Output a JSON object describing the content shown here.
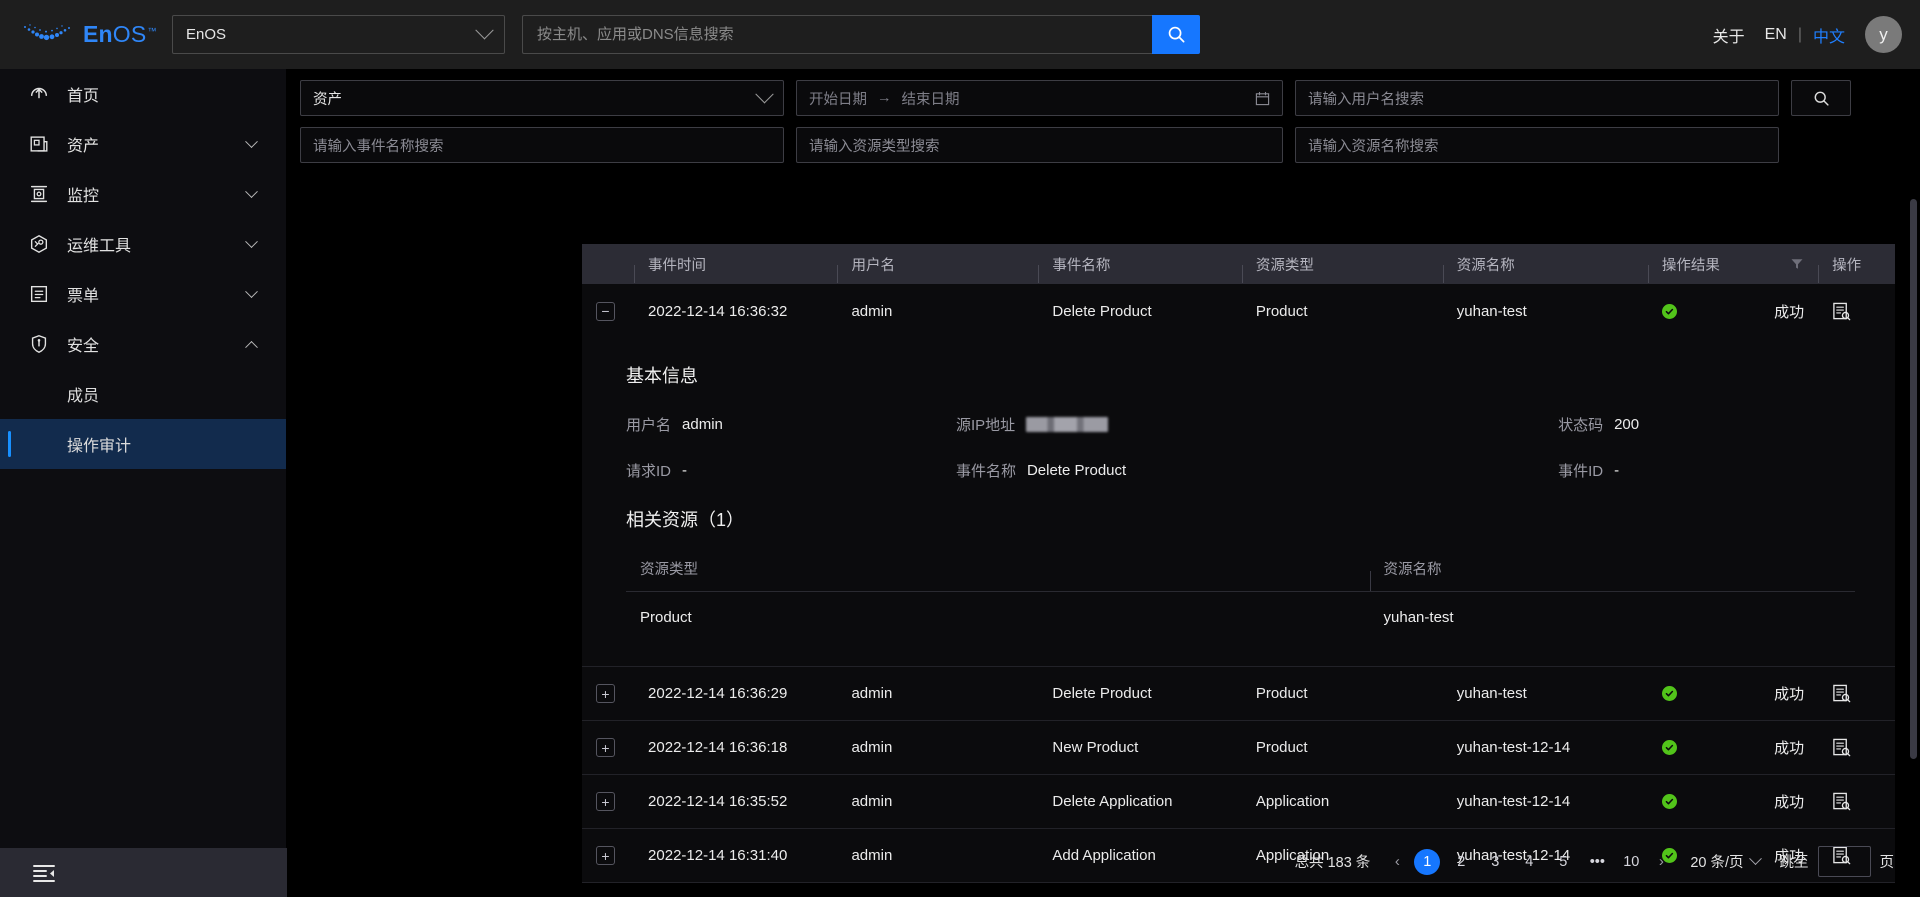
{
  "header": {
    "logo_text_en": "En",
    "logo_text_os": "OS",
    "logo_tm": "™",
    "app_selector_value": "EnOS",
    "search_placeholder": "按主机、应用或DNS信息搜索",
    "about_label": "关于",
    "lang_en": "EN",
    "lang_sep": "|",
    "lang_zh": "中文",
    "avatar_initial": "y"
  },
  "sidebar": {
    "items": [
      {
        "label": "首页",
        "icon": "home-icon",
        "expandable": false
      },
      {
        "label": "资产",
        "icon": "assets-icon",
        "expandable": true,
        "expanded": false
      },
      {
        "label": "监控",
        "icon": "monitor-icon",
        "expandable": true,
        "expanded": false
      },
      {
        "label": "运维工具",
        "icon": "ops-tools-icon",
        "expandable": true,
        "expanded": false
      },
      {
        "label": "票单",
        "icon": "ticket-icon",
        "expandable": true,
        "expanded": false
      },
      {
        "label": "安全",
        "icon": "shield-icon",
        "expandable": true,
        "expanded": true
      }
    ],
    "sub_items": [
      {
        "label": "成员",
        "active": false
      },
      {
        "label": "操作审计",
        "active": true
      }
    ],
    "collapse_icon": "menu-collapse-icon"
  },
  "filters": {
    "category_value": "资产",
    "date_start_placeholder": "开始日期",
    "date_range_arrow": "→",
    "date_end_placeholder": "结束日期",
    "calendar_icon": "calendar-icon",
    "username_placeholder": "请输入用户名搜索",
    "event_name_placeholder": "请输入事件名称搜索",
    "resource_type_placeholder": "请输入资源类型搜索",
    "resource_name_placeholder": "请输入资源名称搜索",
    "search_button_icon": "search-icon"
  },
  "table": {
    "columns": [
      "",
      "事件时间",
      "用户名",
      "事件名称",
      "资源类型",
      "资源名称",
      "操作结果",
      "操作"
    ],
    "filter_icon": "filter-icon",
    "rows": [
      {
        "expanded": true,
        "toggle": "−",
        "time": "2022-12-14 16:36:32",
        "user": "admin",
        "event": "Delete Product",
        "res_type": "Product",
        "res_name": "yuhan-test",
        "result": "成功",
        "action_icon": "detail-log-icon"
      },
      {
        "expanded": false,
        "toggle": "+",
        "time": "2022-12-14 16:36:29",
        "user": "admin",
        "event": "Delete Product",
        "res_type": "Product",
        "res_name": "yuhan-test",
        "result": "成功",
        "action_icon": "detail-log-icon"
      },
      {
        "expanded": false,
        "toggle": "+",
        "time": "2022-12-14 16:36:18",
        "user": "admin",
        "event": "New Product",
        "res_type": "Product",
        "res_name": "yuhan-test-12-14",
        "result": "成功",
        "action_icon": "detail-log-icon"
      },
      {
        "expanded": false,
        "toggle": "+",
        "time": "2022-12-14 16:35:52",
        "user": "admin",
        "event": "Delete Application",
        "res_type": "Application",
        "res_name": "yuhan-test-12-14",
        "result": "成功",
        "action_icon": "detail-log-icon"
      },
      {
        "expanded": false,
        "toggle": "+",
        "time": "2022-12-14 16:31:40",
        "user": "admin",
        "event": "Add Application",
        "res_type": "Application",
        "res_name": "yuhan-test-12-14",
        "result": "成功",
        "action_icon": "detail-log-icon"
      }
    ]
  },
  "detail": {
    "basic_title": "基本信息",
    "username_label": "用户名",
    "username_value": "admin",
    "source_ip_label": "源IP地址",
    "source_ip_value": "",
    "status_code_label": "状态码",
    "status_code_value": "200",
    "request_id_label": "请求ID",
    "request_id_value": "-",
    "event_name_label": "事件名称",
    "event_name_value": "Delete Product",
    "event_id_label": "事件ID",
    "event_id_value": "-",
    "related_title": "相关资源（1）",
    "related_columns": [
      "资源类型",
      "资源名称"
    ],
    "related_rows": [
      {
        "res_type": "Product",
        "res_name": "yuhan-test"
      }
    ]
  },
  "pagination": {
    "total_text": "总共 183 条",
    "prev": "‹",
    "pages": [
      "1",
      "2",
      "3",
      "4",
      "5",
      "•••",
      "10"
    ],
    "current_page": "1",
    "next": "›",
    "page_size": "20 条/页",
    "jump_label": "跳至",
    "jump_value": "",
    "jump_unit": "页"
  },
  "colors": {
    "accent": "#1677ff",
    "success": "#52c41a",
    "sidebar_active_bg": "#122b4d",
    "header_bg": "#1e1e1e"
  }
}
